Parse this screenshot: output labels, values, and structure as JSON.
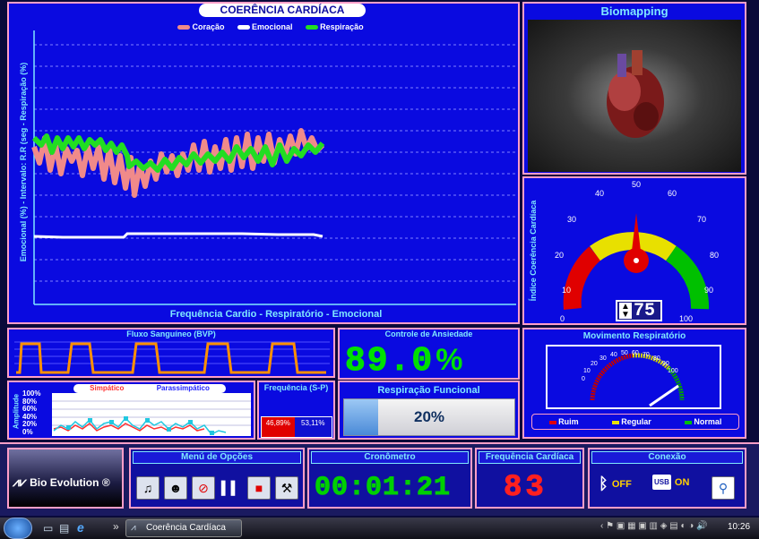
{
  "chart": {
    "title": "COERÊNCIA CARDÍACA",
    "legend": [
      {
        "label": "Coração",
        "color": "#f08a8a"
      },
      {
        "label": "Emocional",
        "color": "#ffffff"
      },
      {
        "label": "Respiração",
        "color": "#22dd22"
      }
    ],
    "ylabel": "Emocional (%) - Intervalo: R.R (seg - Respiração (%)",
    "xlabel": "Frequência Cardio - Respiratório - Emocional"
  },
  "biomapping": {
    "title": "Biomapping"
  },
  "gauge": {
    "vlabel": "Índice Coerência Cardíaca",
    "ticks": [
      "0",
      "10",
      "20",
      "30",
      "40",
      "50",
      "60",
      "70",
      "80",
      "90",
      "100"
    ],
    "value": "75",
    "value_num": 75
  },
  "bvp": {
    "title": "Fluxo Sanguíneo (BVP)"
  },
  "anxiety": {
    "title": "Controle de Ansiedade",
    "value": "89.0",
    "unit": "%"
  },
  "respiratory_movement": {
    "title": "Movimento Respiratório",
    "ticks": [
      "0",
      "10",
      "20",
      "30",
      "40",
      "50",
      "60",
      "70",
      "80",
      "90",
      "100"
    ],
    "legend": [
      {
        "label": "Ruim",
        "color": "#e00000"
      },
      {
        "label": "Regular",
        "color": "#e8e000"
      },
      {
        "label": "Normal",
        "color": "#00c000"
      }
    ]
  },
  "amplitude": {
    "ylabel": "Amplitude",
    "ticks": [
      "100%",
      "80%",
      "60%",
      "40%",
      "20%",
      "0%"
    ],
    "legend": [
      {
        "label": "Simpático",
        "color": "#ff3030"
      },
      {
        "label": "Parassimpático",
        "color": "#2020ff"
      }
    ]
  },
  "sp": {
    "title": "Frequência (S-P)",
    "s_value": "46,89%",
    "p_value": "53,11%",
    "s_fraction": 0.4689
  },
  "functional_breathing": {
    "title": "Respiração Funcional",
    "value": "20%",
    "fraction": 0.2
  },
  "logo": {
    "text": "Bio Evolution",
    "mark": "®"
  },
  "menu": {
    "title": "Menú de Opções"
  },
  "chrono": {
    "title": "Cronômetro",
    "value": "00:01:21"
  },
  "heart_rate": {
    "title": "Frequência Cardíaca",
    "value": "83"
  },
  "connection": {
    "title": "Conexão",
    "bt_state": "OFF",
    "usb_state": "ON"
  },
  "taskbar": {
    "window_label": "Coerência Cardíaca",
    "clock": "10:26",
    "arrow": "»"
  }
}
